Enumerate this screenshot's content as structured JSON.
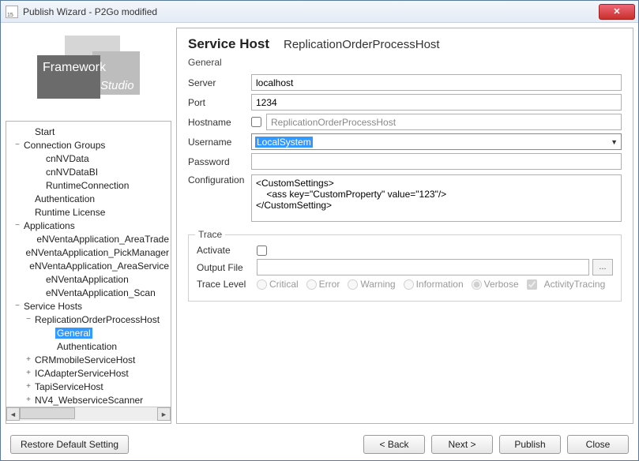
{
  "window": {
    "title": "Publish Wizard - P2Go modified"
  },
  "tree": {
    "items": [
      {
        "indent": 1,
        "exp": "",
        "label": "Start"
      },
      {
        "indent": 0,
        "exp": "−",
        "label": "Connection Groups"
      },
      {
        "indent": 2,
        "exp": "",
        "label": "cnNVData"
      },
      {
        "indent": 2,
        "exp": "",
        "label": "cnNVDataBI"
      },
      {
        "indent": 2,
        "exp": "",
        "label": "RuntimeConnection"
      },
      {
        "indent": 1,
        "exp": "",
        "label": "Authentication"
      },
      {
        "indent": 1,
        "exp": "",
        "label": "Runtime License"
      },
      {
        "indent": 0,
        "exp": "−",
        "label": "Applications"
      },
      {
        "indent": 2,
        "exp": "",
        "label": "eNVentaApplication_AreaTrade"
      },
      {
        "indent": 2,
        "exp": "",
        "label": "eNVentaApplication_PickManager"
      },
      {
        "indent": 2,
        "exp": "",
        "label": "eNVentaApplication_AreaService"
      },
      {
        "indent": 2,
        "exp": "",
        "label": "eNVentaApplication"
      },
      {
        "indent": 2,
        "exp": "",
        "label": "eNVentaApplication_Scan"
      },
      {
        "indent": 0,
        "exp": "−",
        "label": "Service Hosts"
      },
      {
        "indent": 1,
        "exp": "−",
        "label": "ReplicationOrderProcessHost"
      },
      {
        "indent": 3,
        "exp": "",
        "label": "General",
        "selected": true
      },
      {
        "indent": 3,
        "exp": "",
        "label": "Authentication"
      },
      {
        "indent": 1,
        "exp": "+",
        "label": "CRMmobileServiceHost"
      },
      {
        "indent": 1,
        "exp": "+",
        "label": "ICAdapterServiceHost"
      },
      {
        "indent": 1,
        "exp": "+",
        "label": "TapiServiceHost"
      },
      {
        "indent": 1,
        "exp": "+",
        "label": "NV4_WebserviceScanner"
      }
    ]
  },
  "header": {
    "title": "Service Host",
    "name": "ReplicationOrderProcessHost",
    "section": "General"
  },
  "form": {
    "server_label": "Server",
    "server_value": "localhost",
    "port_label": "Port",
    "port_value": "1234",
    "hostname_label": "Hostname",
    "hostname_value": "ReplicationOrderProcessHost",
    "username_label": "Username",
    "username_value": "LocalSystem",
    "password_label": "Password",
    "password_value": "",
    "config_label": "Configuration",
    "config_value": "<CustomSettings>\n    <ass key=\"CustomProperty\" value=\"123\"/>\n</CustomSetting>"
  },
  "trace": {
    "legend": "Trace",
    "activate_label": "Activate",
    "output_label": "Output File",
    "output_value": "",
    "level_label": "Trace Level",
    "options": {
      "critical": "Critical",
      "error": "Error",
      "warning": "Warning",
      "information": "Information",
      "verbose": "Verbose",
      "activity": "ActivityTracing"
    },
    "browse": "..."
  },
  "footer": {
    "restore": "Restore Default Setting",
    "back": "< Back",
    "next": "Next >",
    "publish": "Publish",
    "close": "Close"
  },
  "logo": {
    "line1": "Framework",
    "line2": "Studio"
  }
}
